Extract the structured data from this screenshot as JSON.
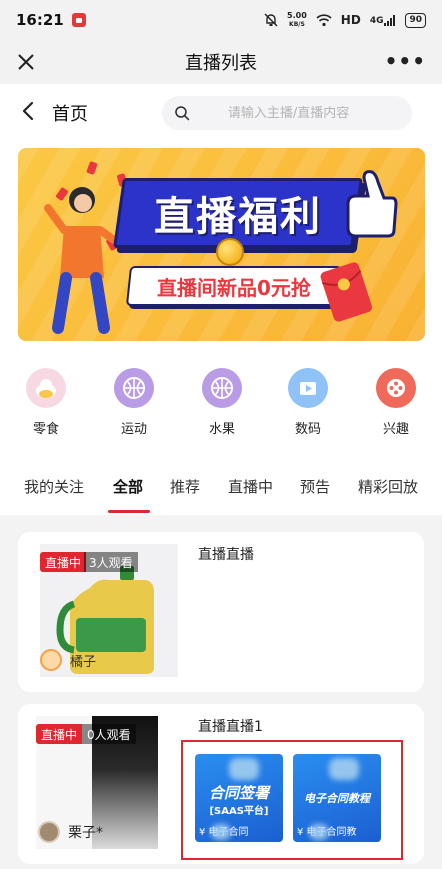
{
  "status_bar": {
    "time": "16:21",
    "net_speed_value": "5.00",
    "net_speed_unit": "KB/S",
    "network": "HD",
    "signal": "4G",
    "battery": "90"
  },
  "nav": {
    "title": "直播列表",
    "more": "•••"
  },
  "header": {
    "title": "首页",
    "search_placeholder": "请输入主播/直播内容"
  },
  "banner": {
    "title": "直播福利",
    "subtitle": "直播间新品0元抢"
  },
  "categories": [
    {
      "label": "零食",
      "icon": "snack-icon",
      "color": "#f7d9e4"
    },
    {
      "label": "运动",
      "icon": "basketball-icon",
      "color": "#b99be6"
    },
    {
      "label": "水果",
      "icon": "basketball-icon",
      "color": "#b99be6"
    },
    {
      "label": "数码",
      "icon": "video-icon",
      "color": "#8fc2f7"
    },
    {
      "label": "兴趣",
      "icon": "film-reel-icon",
      "color": "#f06a5c"
    }
  ],
  "tabs": [
    {
      "label": "我的关注"
    },
    {
      "label": "全部",
      "active": true
    },
    {
      "label": "推荐"
    },
    {
      "label": "直播中"
    },
    {
      "label": "预告"
    },
    {
      "label": "精彩回放"
    }
  ],
  "live_cards": [
    {
      "title": "直播直播",
      "status": "直播中",
      "viewers": "3人观看",
      "host": "橘子"
    },
    {
      "title": "直播直播1",
      "status": "直播中",
      "viewers": "0人观看",
      "host": "栗子*",
      "products": [
        {
          "title": "合同签署",
          "subtitle": "[SAAS平台]",
          "price": "¥ 电子合同"
        },
        {
          "title": "电子合同教程",
          "subtitle": "",
          "price": "¥ 电子合同教"
        }
      ]
    }
  ],
  "colors": {
    "accent": "#e0262e",
    "banner_bg": "#f9b233",
    "banner_title_bg": "#2b33c8"
  }
}
